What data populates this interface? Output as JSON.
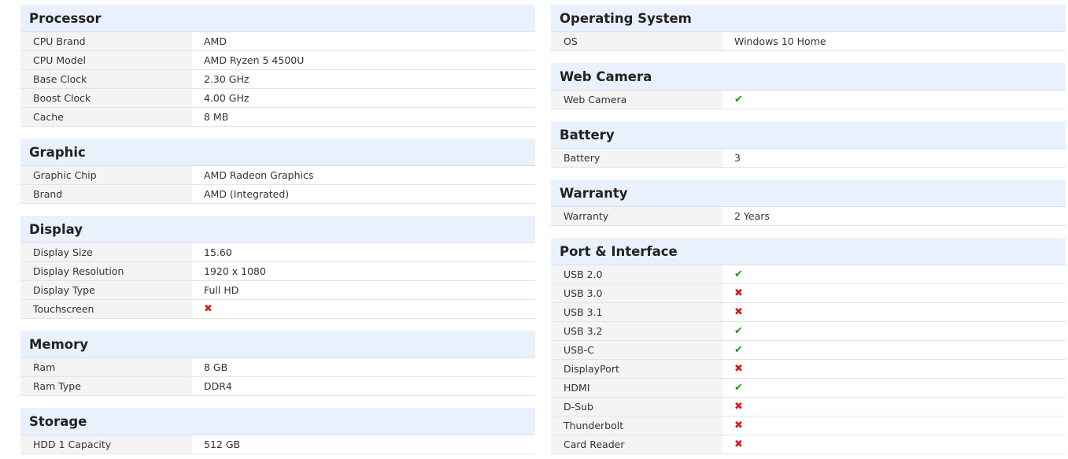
{
  "processor": {
    "title": "Processor",
    "rows": [
      {
        "label": "CPU Brand",
        "value": "AMD"
      },
      {
        "label": "CPU Model",
        "value": "AMD Ryzen 5 4500U"
      },
      {
        "label": "Base Clock",
        "value": "2.30 GHz"
      },
      {
        "label": "Boost Clock",
        "value": "4.00 GHz"
      },
      {
        "label": "Cache",
        "value": "8 MB"
      }
    ]
  },
  "graphic": {
    "title": "Graphic",
    "rows": [
      {
        "label": "Graphic Chip",
        "value": "AMD Radeon Graphics"
      },
      {
        "label": "Brand",
        "value": "AMD (Integrated)"
      }
    ]
  },
  "display": {
    "title": "Display",
    "rows": [
      {
        "label": "Display Size",
        "value": "15.60"
      },
      {
        "label": "Display Resolution",
        "value": "1920 x 1080"
      },
      {
        "label": "Display Type",
        "value": "Full HD"
      },
      {
        "label": "Touchscreen",
        "icon": "cross-icon"
      }
    ]
  },
  "memory": {
    "title": "Memory",
    "rows": [
      {
        "label": "Ram",
        "value": "8 GB"
      },
      {
        "label": "Ram Type",
        "value": "DDR4"
      }
    ]
  },
  "storage": {
    "title": "Storage",
    "rows": [
      {
        "label": "HDD 1 Capacity",
        "value": "512 GB"
      }
    ]
  },
  "operating_system": {
    "title": "Operating System",
    "rows": [
      {
        "label": "OS",
        "value": "Windows 10 Home"
      }
    ]
  },
  "web_camera": {
    "title": "Web Camera",
    "rows": [
      {
        "label": "Web Camera",
        "icon": "check-icon"
      }
    ]
  },
  "battery": {
    "title": "Battery",
    "rows": [
      {
        "label": "Battery",
        "value": "3"
      }
    ]
  },
  "warranty": {
    "title": "Warranty",
    "rows": [
      {
        "label": "Warranty",
        "value": "2 Years"
      }
    ]
  },
  "ports": {
    "title": "Port & Interface",
    "rows": [
      {
        "label": "USB 2.0",
        "icon": "check-icon"
      },
      {
        "label": "USB 3.0",
        "icon": "cross-icon"
      },
      {
        "label": "USB 3.1",
        "icon": "cross-icon"
      },
      {
        "label": "USB 3.2",
        "icon": "check-icon"
      },
      {
        "label": "USB-C",
        "icon": "check-icon"
      },
      {
        "label": "DisplayPort",
        "icon": "cross-icon"
      },
      {
        "label": "HDMI",
        "icon": "check-icon"
      },
      {
        "label": "D-Sub",
        "icon": "cross-icon"
      },
      {
        "label": "Thunderbolt",
        "icon": "cross-icon"
      },
      {
        "label": "Card Reader",
        "icon": "cross-icon"
      }
    ]
  },
  "colors": {
    "header_bg": "#e9f1fc",
    "label_bg": "#f4f4f4",
    "check": "#2e8b2e",
    "cross": "#d21e1e"
  }
}
